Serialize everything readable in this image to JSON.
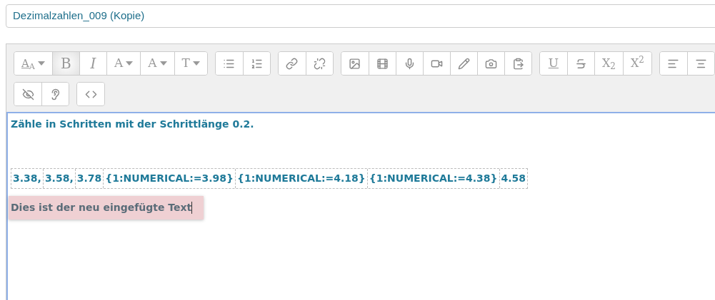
{
  "title_field": {
    "value": "Dezimalzahlen_009 (Kopie)"
  },
  "toolbar": {
    "rows": [
      [
        {
          "tools": [
            {
              "kind": "styles",
              "label": "A$_{A}$",
              "on": false
            },
            {
              "kind": "bold",
              "label": "B",
              "on": true
            },
            {
              "kind": "italic",
              "label": "I",
              "on": false
            },
            {
              "kind": "font-color",
              "label": "A",
              "on": false
            },
            {
              "kind": "highlight",
              "label": "A",
              "on": false
            },
            {
              "kind": "font-size",
              "label": "T",
              "on": false
            }
          ]
        },
        {
          "tools": [
            {
              "kind": "bullets",
              "on": false
            },
            {
              "kind": "numbering",
              "on": false
            }
          ]
        },
        {
          "tools": [
            {
              "kind": "link",
              "on": false
            },
            {
              "kind": "unlink",
              "on": false
            }
          ]
        },
        {
          "tools": [
            {
              "kind": "image",
              "on": false
            },
            {
              "kind": "media",
              "on": false
            },
            {
              "kind": "audio",
              "on": false
            },
            {
              "kind": "video",
              "on": false
            },
            {
              "kind": "draw",
              "on": false
            },
            {
              "kind": "photo",
              "on": false
            },
            {
              "kind": "files",
              "on": false
            }
          ]
        },
        {
          "tools": [
            {
              "kind": "underline",
              "label": "U",
              "on": false
            },
            {
              "kind": "strike",
              "on": false
            },
            {
              "kind": "subscript",
              "label": "X$_{2}$",
              "on": false
            },
            {
              "kind": "superscript",
              "label": "X$^{2}$",
              "on": false
            }
          ]
        },
        {
          "tools": [
            {
              "kind": "align-left",
              "on": false
            },
            {
              "kind": "more",
              "on": false
            }
          ]
        }
      ],
      [
        {
          "tools": [
            {
              "kind": "accessibility",
              "on": false
            },
            {
              "kind": "screenreader",
              "on": false
            }
          ]
        },
        {
          "tools": [
            {
              "kind": "html",
              "on": false
            }
          ]
        }
      ]
    ]
  },
  "content": [
    {
      "kind": "heading",
      "text": "Zähle in Schritten mit der Schrittlänge 0.2."
    },
    {
      "kind": "cells",
      "cells": [
        "3.38,",
        "3.58,",
        "3.78",
        "{1:NUMERICAL:=3.98}",
        "{1:NUMERICAL:=4.18}",
        "{1:NUMERICAL:=4.38}",
        "4.58"
      ]
    },
    {
      "kind": "highlight",
      "text": "Dies ist der neu eingefügte Text"
    }
  ]
}
